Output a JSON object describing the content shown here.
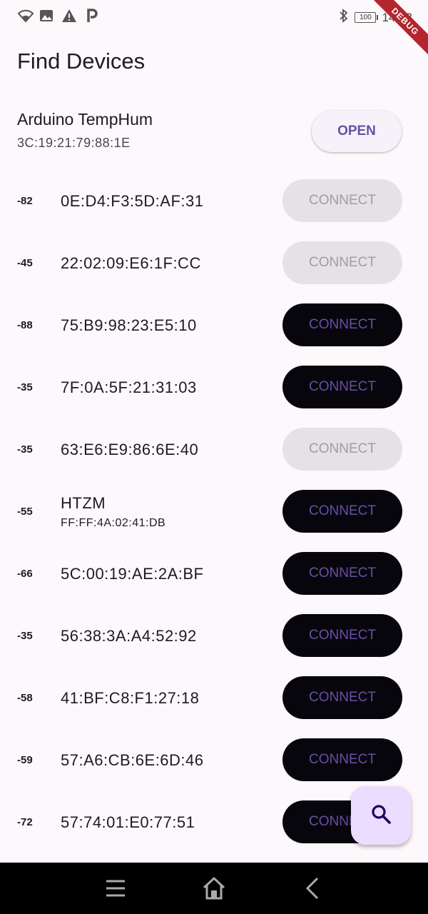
{
  "status_bar": {
    "left_icons": [
      "wifi-icon",
      "image-icon",
      "warning-icon",
      "parking-icon"
    ],
    "bluetooth_icon": "bluetooth-icon",
    "battery": "100",
    "time": "14:53"
  },
  "debug_banner": "DEBUG",
  "app": {
    "title": "Find Devices"
  },
  "connected_device": {
    "name": "Arduino TempHum",
    "mac": "3C:19:21:79:88:1E",
    "button_label": "OPEN"
  },
  "scan_results": [
    {
      "rssi": "-82",
      "title": "0E:D4:F3:5D:AF:31",
      "subtitle": "",
      "button_label": "CONNECT",
      "enabled": false
    },
    {
      "rssi": "-45",
      "title": "22:02:09:E6:1F:CC",
      "subtitle": "",
      "button_label": "CONNECT",
      "enabled": false
    },
    {
      "rssi": "-88",
      "title": "75:B9:98:23:E5:10",
      "subtitle": "",
      "button_label": "CONNECT",
      "enabled": true
    },
    {
      "rssi": "-35",
      "title": "7F:0A:5F:21:31:03",
      "subtitle": "",
      "button_label": "CONNECT",
      "enabled": true
    },
    {
      "rssi": "-35",
      "title": "63:E6:E9:86:6E:40",
      "subtitle": "",
      "button_label": "CONNECT",
      "enabled": false
    },
    {
      "rssi": "-55",
      "title": "HTZM",
      "subtitle": "FF:FF:4A:02:41:DB",
      "button_label": "CONNECT",
      "enabled": true
    },
    {
      "rssi": "-66",
      "title": "5C:00:19:AE:2A:BF",
      "subtitle": "",
      "button_label": "CONNECT",
      "enabled": true
    },
    {
      "rssi": "-35",
      "title": "56:38:3A:A4:52:92",
      "subtitle": "",
      "button_label": "CONNECT",
      "enabled": true
    },
    {
      "rssi": "-58",
      "title": "41:BF:C8:F1:27:18",
      "subtitle": "",
      "button_label": "CONNECT",
      "enabled": true
    },
    {
      "rssi": "-59",
      "title": "57:A6:CB:6E:6D:46",
      "subtitle": "",
      "button_label": "CONNECT",
      "enabled": true
    },
    {
      "rssi": "-72",
      "title": "57:74:01:E0:77:51",
      "subtitle": "",
      "button_label": "CONNECT",
      "enabled": true
    }
  ],
  "fab": {
    "icon": "search-icon"
  },
  "nav_bar": {
    "icons": [
      "menu-icon",
      "home-icon",
      "back-icon"
    ]
  },
  "colors": {
    "background": "#fdf8fb",
    "accent": "#6750a4",
    "enabled_button": "#08060d",
    "disabled_button": "#e6e1e5",
    "disabled_text": "#a09ca3",
    "fab": "#eaddff",
    "debug_ribbon": "#b3262d"
  }
}
